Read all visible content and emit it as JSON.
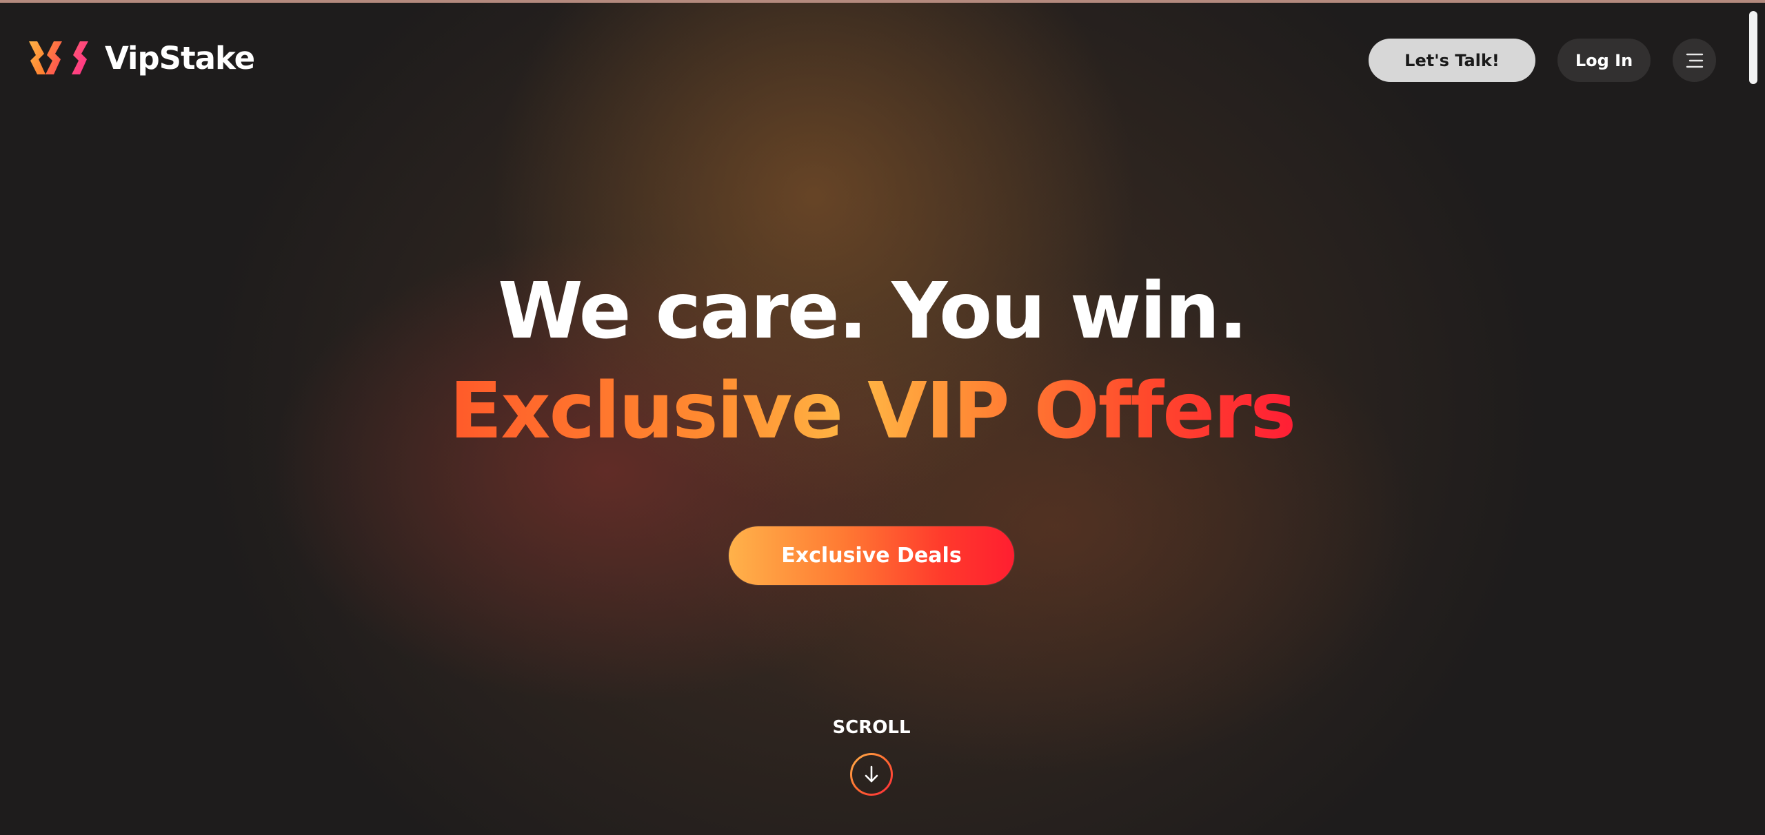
{
  "header": {
    "brand": "VipStake",
    "lets_talk_label": "Let's Talk!",
    "login_label": "Log In",
    "menu_icon": "hamburger-menu-icon"
  },
  "hero": {
    "headline": "We care. You win.",
    "subheadline": "Exclusive VIP Offers",
    "cta_label": "Exclusive Deals",
    "scroll_label": "SCROLL",
    "scroll_icon": "arrow-down-icon"
  },
  "colors": {
    "background": "#1e1c1c",
    "accent_orange": "#ff7a33",
    "accent_yellow": "#ffb745",
    "accent_red": "#ff1e30",
    "logo_orange": "#ff8a3a",
    "logo_pink": "#ff3d7a"
  }
}
